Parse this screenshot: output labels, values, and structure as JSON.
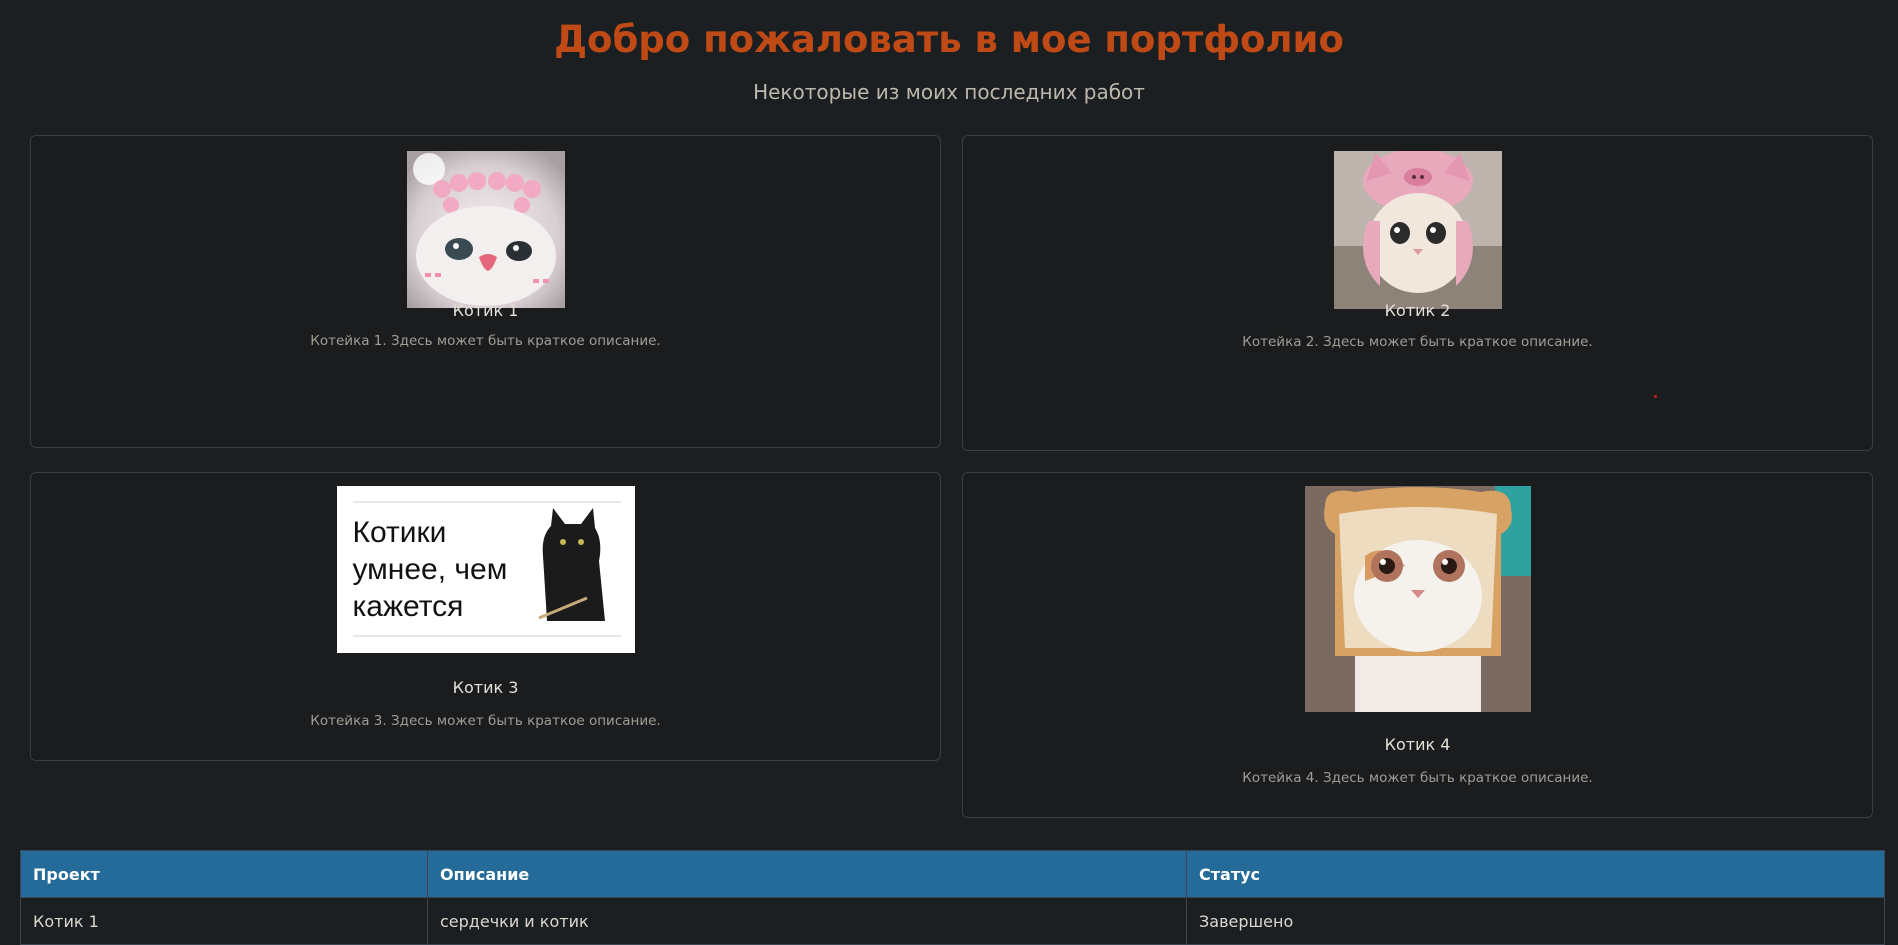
{
  "header": {
    "title": "Добро пожаловать в мое портфолио",
    "subtitle": "Некоторые из моих последних работ"
  },
  "cards": [
    {
      "title": "Котик 1",
      "description": "Котейка 1. Здесь может быть краткое описание.",
      "image": "white-kitten-hearts-photo"
    },
    {
      "title": "Котик 2",
      "description": "Котейка 2. Здесь может быть краткое описание.",
      "image": "kitten-pig-hat-photo"
    },
    {
      "title": "Котик 3",
      "description": "Котейка 3. Здесь может быть краткое описание.",
      "image": "black-cat-meme",
      "image_text": "Котики умнее, чем кажется"
    },
    {
      "title": "Котик 4",
      "description": "Котейка 4. Здесь может быть краткое описание.",
      "image": "cat-in-bread-photo"
    }
  ],
  "table": {
    "headers": [
      "Проект",
      "Описание",
      "Статус"
    ],
    "rows": [
      [
        "Котик 1",
        "сердечки и котик",
        "Завершено"
      ]
    ]
  },
  "colors": {
    "background": "#1c1f21",
    "title": "#bf4a15",
    "table_header": "#246b99"
  }
}
